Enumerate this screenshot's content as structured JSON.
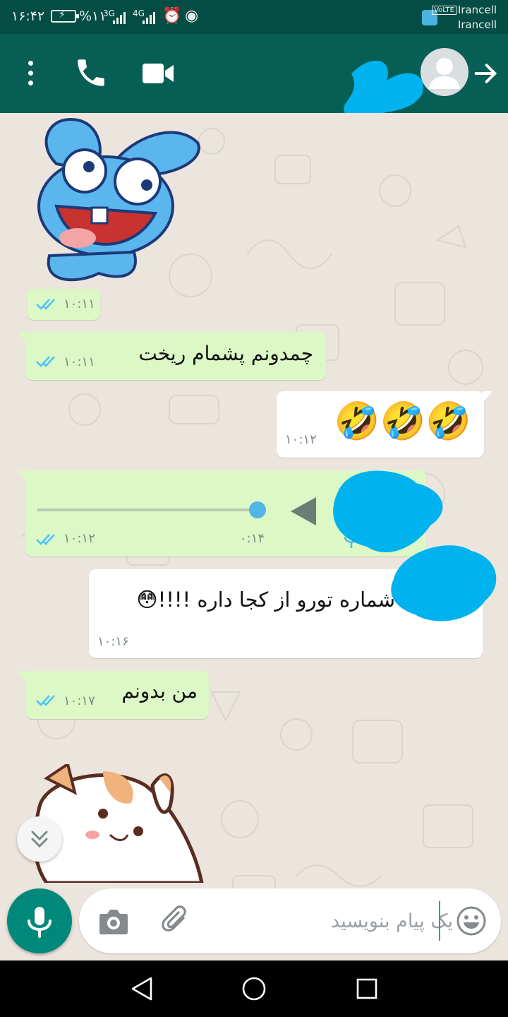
{
  "status_bar": {
    "time": "۱۶:۴۲",
    "battery_percent": "%۱۱",
    "network_1": "3G",
    "network_2": "4G",
    "volte": "VoLTE",
    "carrier_1": "Irancell",
    "carrier_2": "Irancell"
  },
  "app_bar": {
    "color": "#075e54",
    "icons": [
      "more-vertical-icon",
      "voice-call-icon",
      "video-call-icon",
      "back-arrow-icon"
    ]
  },
  "messages": [
    {
      "type": "sticker",
      "sticker": "blue-bunny-sticker",
      "direction": "out",
      "time": "۱۰:۱۱",
      "read": true
    },
    {
      "type": "text",
      "direction": "out",
      "text": "چمدونم پشمام ریخت",
      "time": "۱۰:۱۱",
      "read": true
    },
    {
      "type": "text",
      "direction": "in",
      "text": "🤣🤣🤣",
      "time": "۱۰:۱۲"
    },
    {
      "type": "voice",
      "direction": "out",
      "duration": "۰:۱۴",
      "time": "۱۰:۱۲",
      "read": true,
      "played": 1.0
    },
    {
      "type": "text",
      "direction": "in",
      "text": "شماره تورو از کجا داره !!!!😳",
      "time": "۱۰:۱۶"
    },
    {
      "type": "text",
      "direction": "out",
      "text": "من بدونم",
      "time": "۱۰:۱۷",
      "read": true
    },
    {
      "type": "sticker",
      "sticker": "cat-sticker",
      "direction": "out"
    }
  ],
  "input": {
    "placeholder": "یک پیام بنویسید",
    "value": ""
  },
  "colors": {
    "accent": "#00897b",
    "outgoing_bubble": "#dcf8c6",
    "incoming_bubble": "#ffffff",
    "read_ticks": "#4fc3f7",
    "redaction": "#00b2ee"
  }
}
